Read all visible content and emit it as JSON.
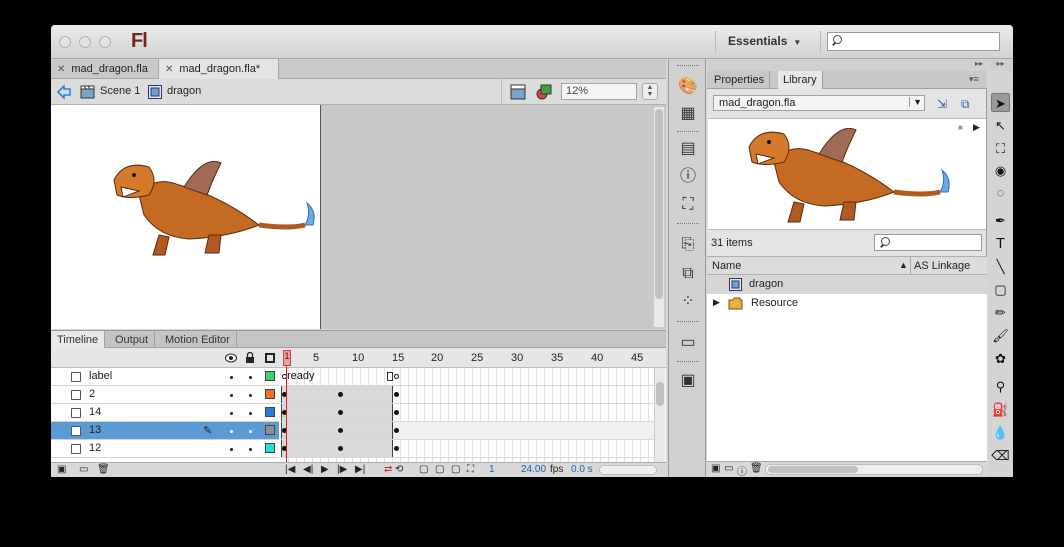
{
  "app": {
    "logo": "Fl",
    "workspace": "Essentials"
  },
  "doc_tabs": [
    {
      "label": "mad_dragon.fla"
    },
    {
      "label": "mad_dragon.fla*"
    }
  ],
  "breadcrumb": {
    "scene": "Scene 1",
    "symbol": "dragon"
  },
  "zoom": "12%",
  "timeline_tabs": [
    "Timeline",
    "Output",
    "Motion Editor"
  ],
  "frame_numbers": [
    "1",
    "5",
    "10",
    "15",
    "20",
    "25",
    "30",
    "35",
    "40",
    "45"
  ],
  "layers": [
    {
      "name": "label",
      "color": "#3ad46a",
      "selected": false
    },
    {
      "name": "2",
      "color": "#f07020",
      "selected": false
    },
    {
      "name": "14",
      "color": "#2080e0",
      "selected": false
    },
    {
      "name": "13",
      "color": "#909090",
      "selected": true
    },
    {
      "name": "12",
      "color": "#20e0e0",
      "selected": false
    }
  ],
  "frame_label": "ready",
  "timeline_footer": {
    "current_frame": "1",
    "fps_value": "24.00",
    "fps_unit": "fps",
    "time": "0.0 s"
  },
  "library": {
    "tabs": [
      "Properties",
      "Library"
    ],
    "file": "mad_dragon.fla",
    "item_count": "31 items",
    "columns": {
      "name": "Name",
      "linkage": "AS Linkage"
    },
    "items": [
      {
        "name": "dragon",
        "type": "movie-clip"
      },
      {
        "name": "Resource",
        "type": "folder"
      }
    ]
  }
}
